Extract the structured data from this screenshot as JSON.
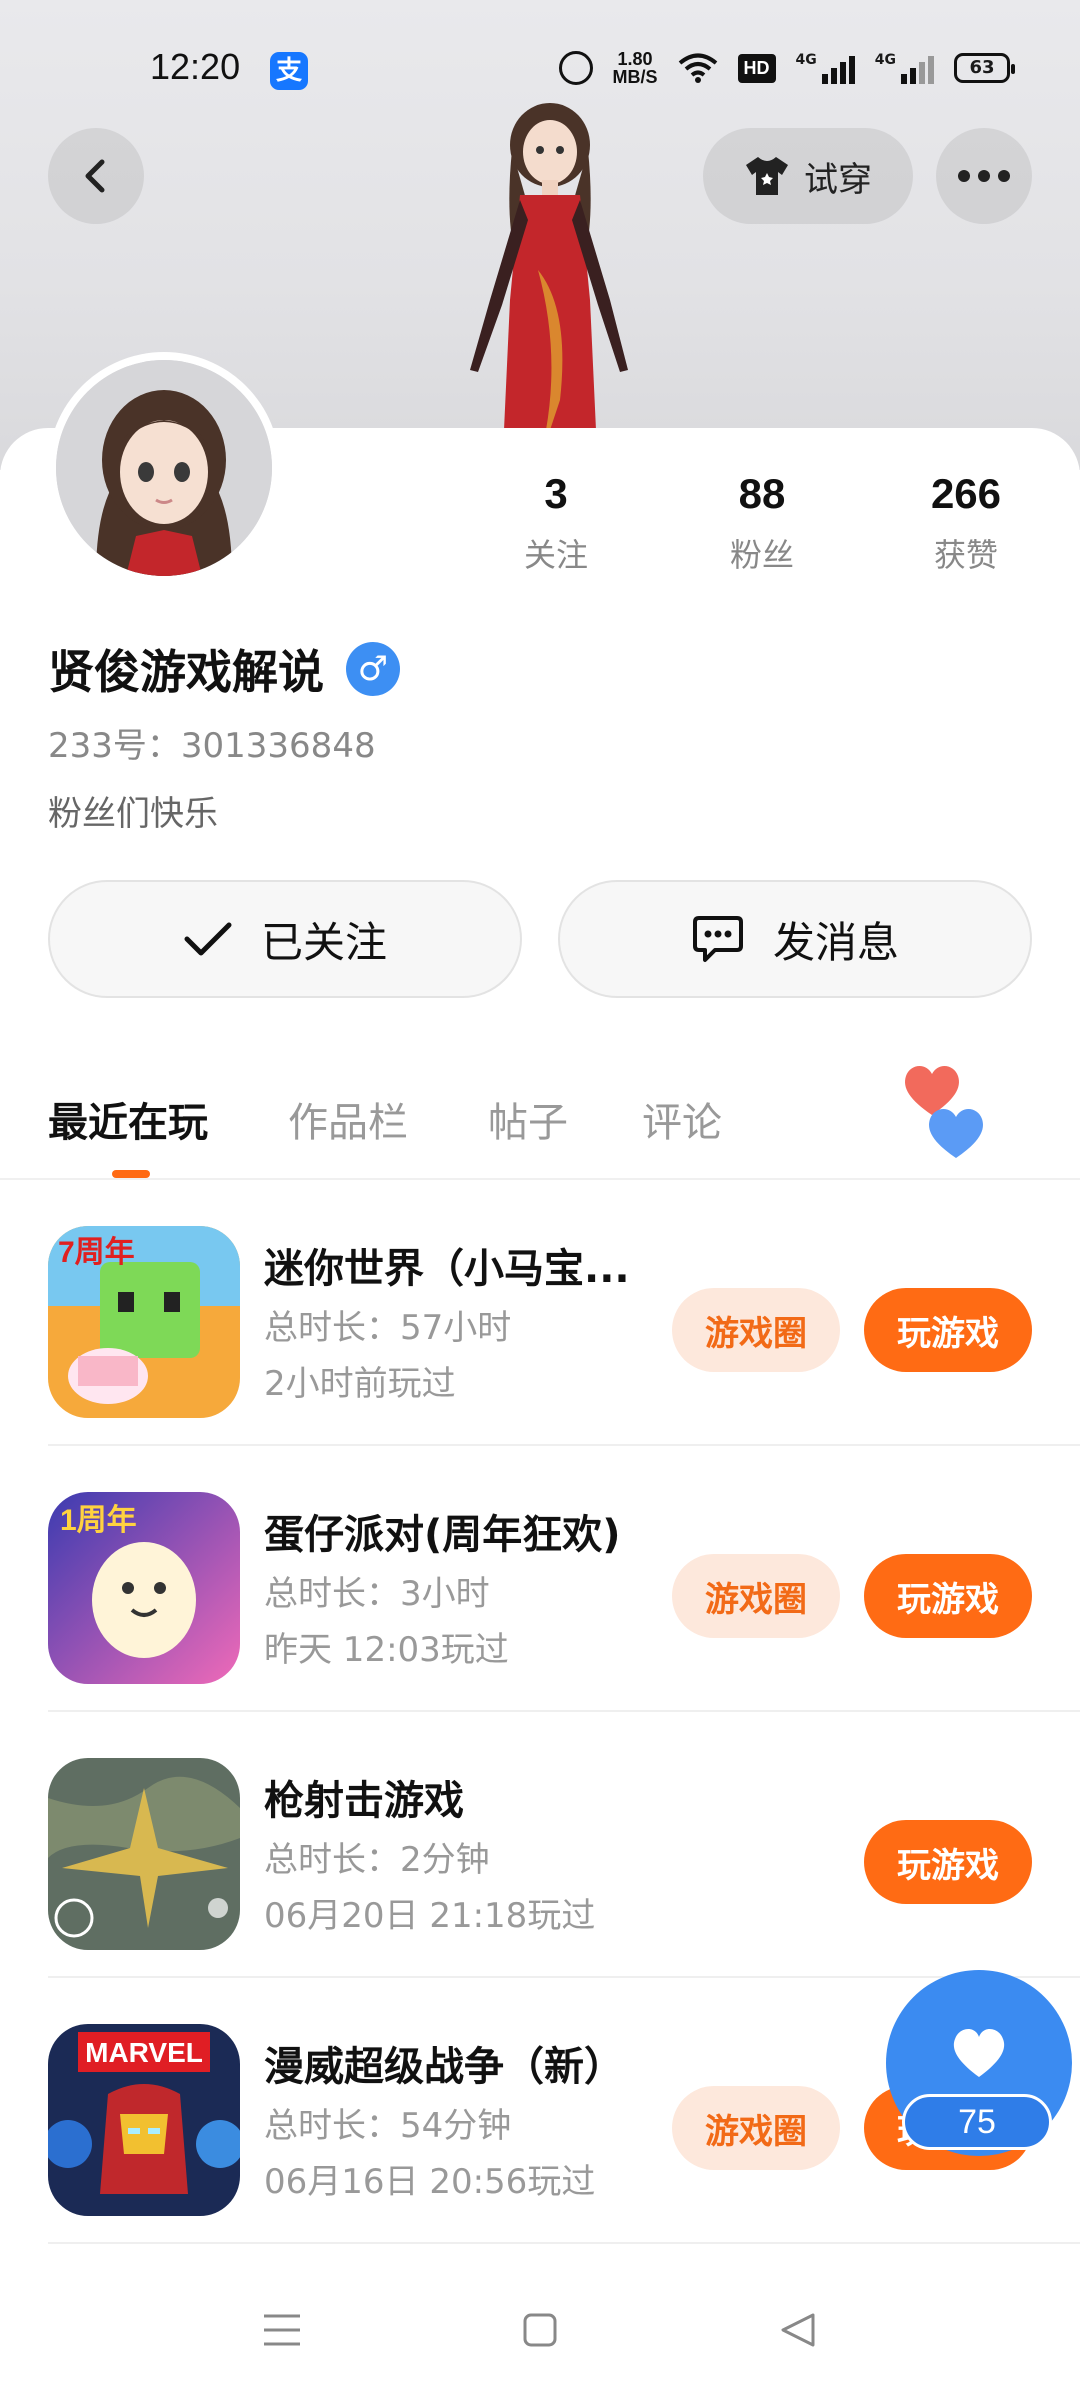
{
  "status_bar": {
    "time": "12:20",
    "alipay_glyph": "支",
    "net_speed_value": "1.80",
    "net_speed_unit": "MB/S",
    "hd_label": "HD",
    "signal1_label": "4G",
    "signal2_label": "4G",
    "battery": "63"
  },
  "header": {
    "tryon_label": "试穿"
  },
  "profile": {
    "stats": [
      {
        "value": "3",
        "label": "关注"
      },
      {
        "value": "88",
        "label": "粉丝"
      },
      {
        "value": "266",
        "label": "获赞"
      }
    ],
    "username": "贤俊游戏解说",
    "gender_symbol": "♂",
    "user_id": "233号：301336848",
    "bio": "粉丝们快乐"
  },
  "actions": {
    "follow_label": "已关注",
    "message_label": "发消息"
  },
  "tabs": [
    {
      "label": "最近在玩",
      "active": true
    },
    {
      "label": "作品栏",
      "active": false
    },
    {
      "label": "帖子",
      "active": false
    },
    {
      "label": "评论",
      "active": false
    }
  ],
  "games": [
    {
      "title": "迷你世界（小马宝...",
      "duration": "总时长：57小时",
      "last_played": "2小时前玩过",
      "circle_label": "游戏圈",
      "play_label": "玩游戏",
      "icon_badge": "7周年"
    },
    {
      "title": "蛋仔派对(周年狂欢)",
      "duration": "总时长：3小时",
      "last_played": "昨天 12:03玩过",
      "circle_label": "游戏圈",
      "play_label": "玩游戏",
      "icon_badge": "1周年"
    },
    {
      "title": "枪射击游戏",
      "duration": "总时长：2分钟",
      "last_played": "06月20日 21:18玩过",
      "circle_label": "",
      "play_label": "玩游戏",
      "icon_badge": ""
    },
    {
      "title": "漫威超级战争（新）",
      "duration": "总时长：54分钟",
      "last_played": "06月16日 20:56玩过",
      "circle_label": "游戏圈",
      "play_label": "玩游戏",
      "icon_badge": "MARVEL"
    }
  ],
  "fab": {
    "count": "75"
  },
  "colors": {
    "accent": "#ff6b14",
    "accent_light": "#fde8dc",
    "blue": "#3b8bf1"
  }
}
